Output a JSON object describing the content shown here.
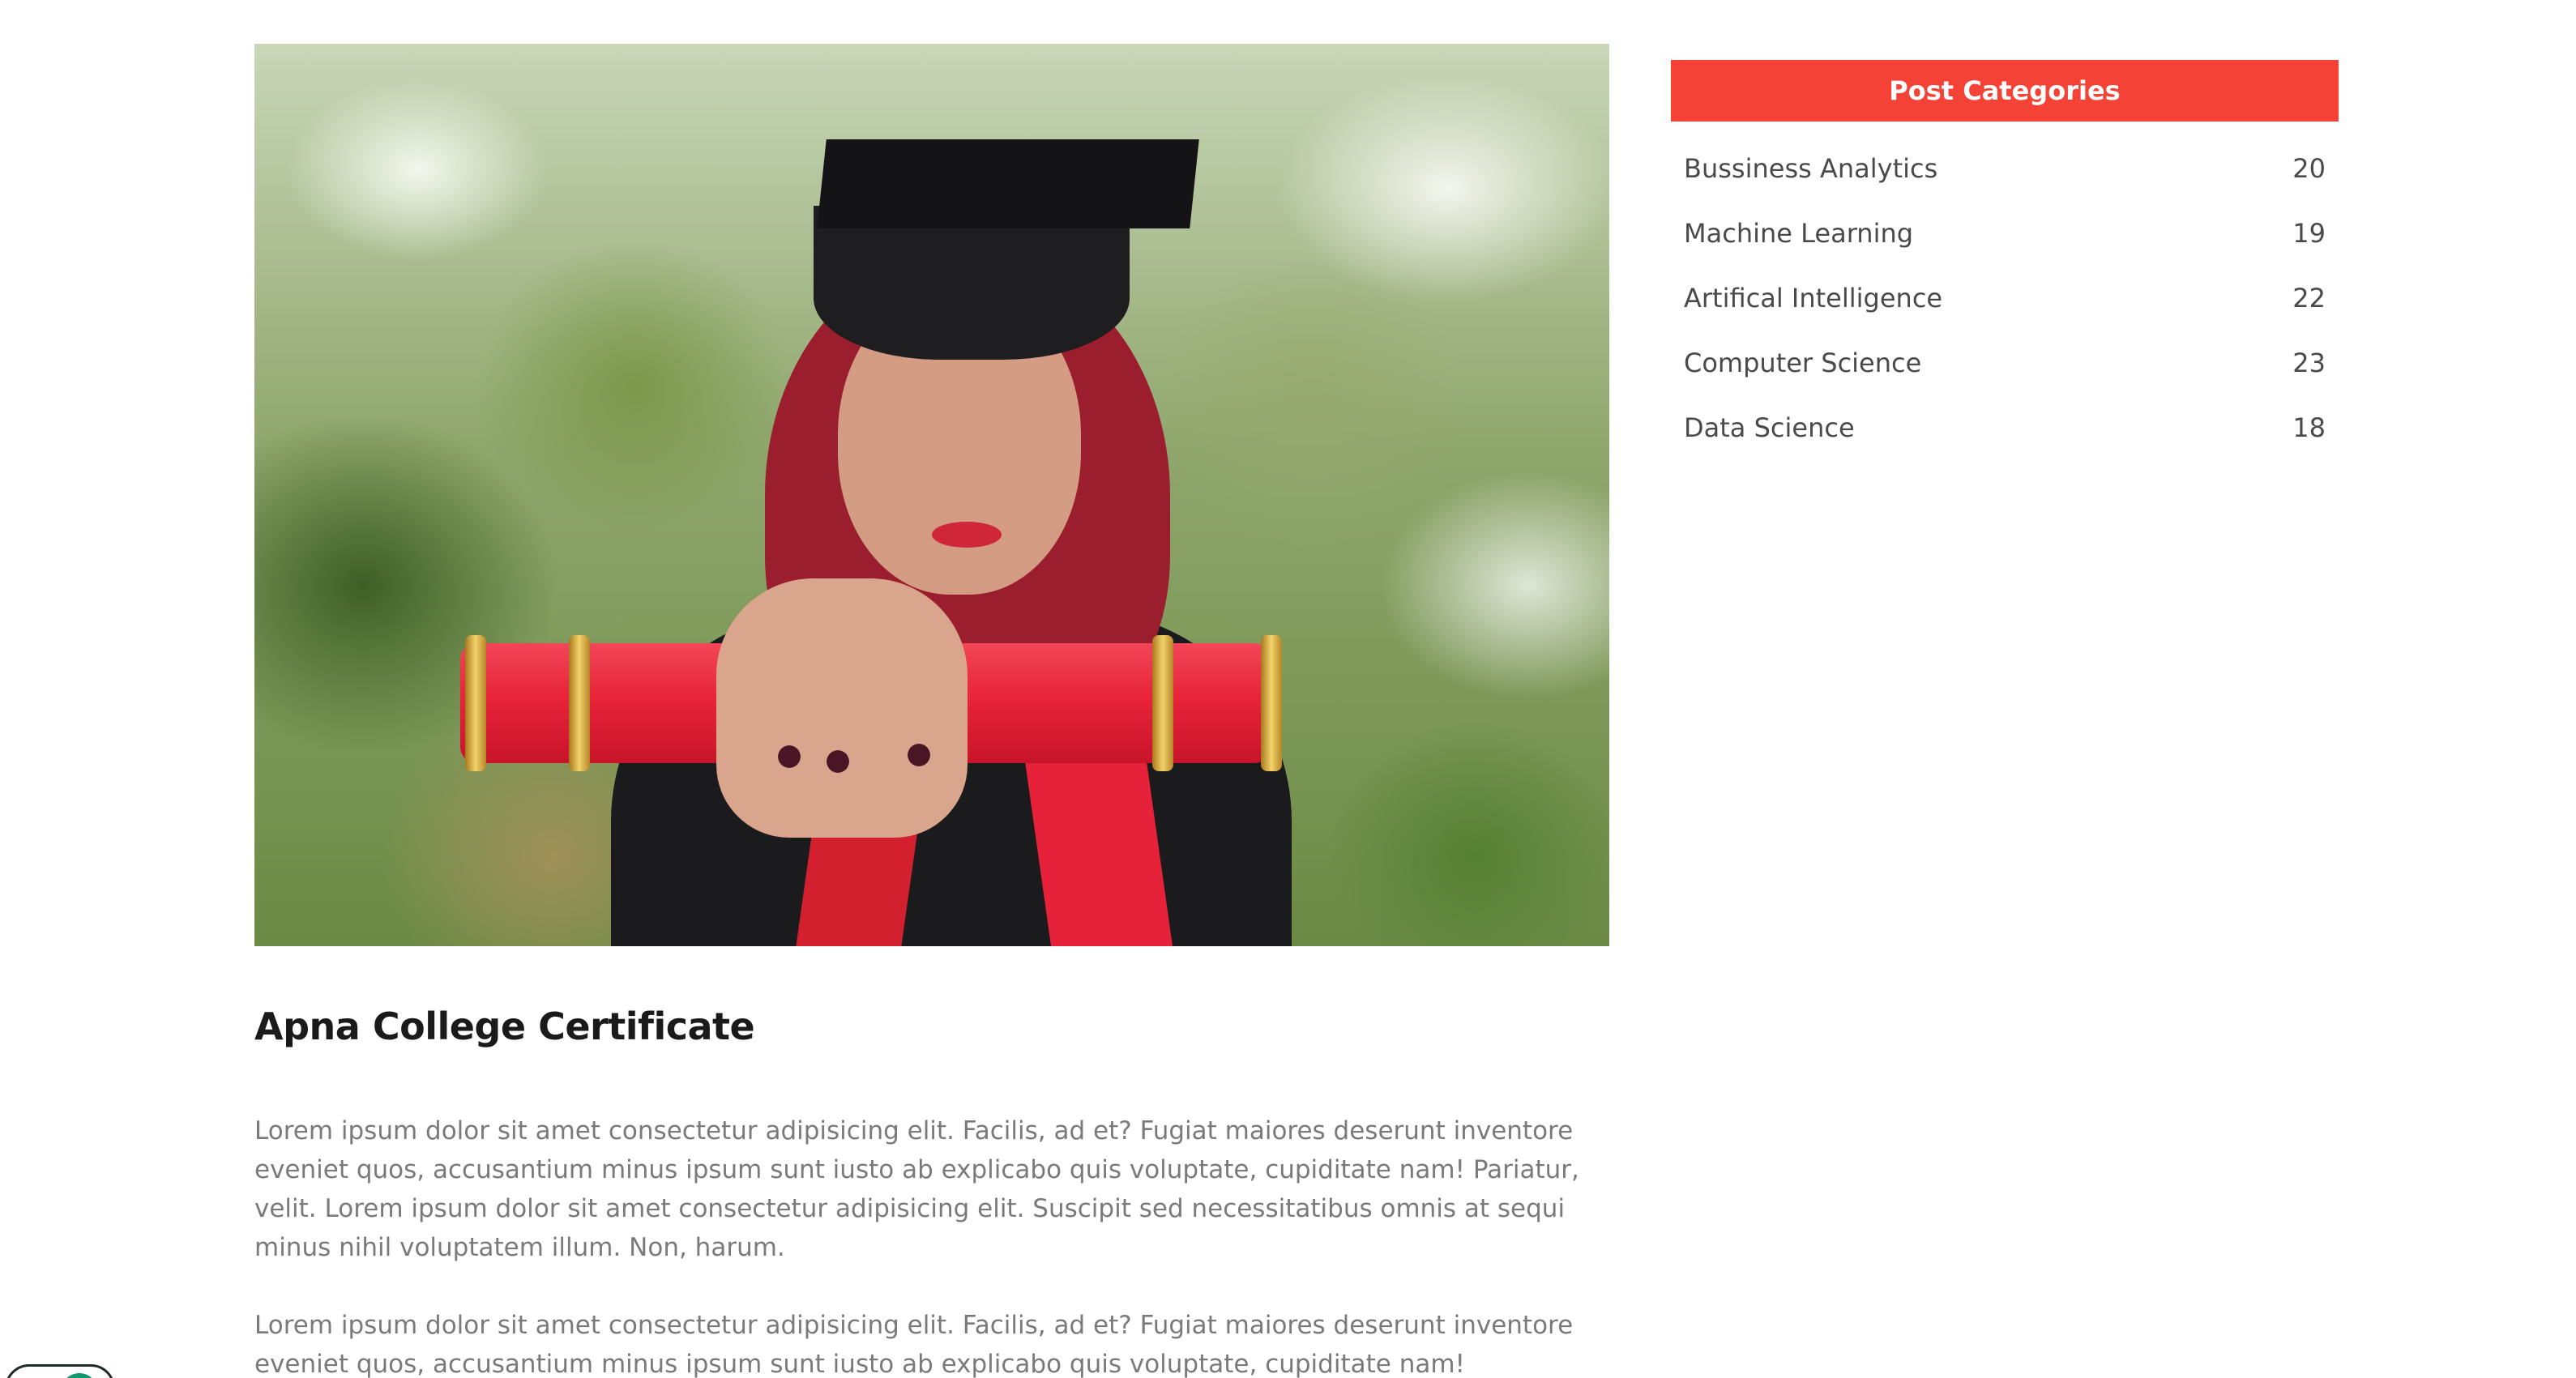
{
  "article": {
    "image_alt": "Graduate holding a red diploma scroll",
    "title": "Apna College Certificate",
    "paragraphs": [
      "Lorem ipsum dolor sit amet consectetur adipisicing elit. Facilis, ad et? Fugiat maiores deserunt inventore eveniet quos, accusantium minus ipsum sunt iusto ab explicabo quis voluptate, cupiditate nam! Pariatur, velit. Lorem ipsum dolor sit amet consectetur adipisicing elit. Suscipit sed necessitatibus omnis at sequi minus nihil voluptatem illum. Non, harum.",
      "Lorem ipsum dolor sit amet consectetur adipisicing elit. Facilis, ad et? Fugiat maiores deserunt inventore eveniet quos, accusantium minus ipsum sunt iusto ab explicabo quis voluptate, cupiditate nam!"
    ]
  },
  "sidebar": {
    "heading": "Post Categories",
    "categories": [
      {
        "label": "Bussiness Analytics",
        "count": "20"
      },
      {
        "label": "Machine Learning",
        "count": "19"
      },
      {
        "label": "Artifical Intelligence",
        "count": "22"
      },
      {
        "label": "Computer Science",
        "count": "23"
      },
      {
        "label": "Data Science",
        "count": "18"
      }
    ]
  },
  "colors": {
    "accent": "#f44336",
    "title_text": "#1a1a1a",
    "body_text": "#7a7a7a",
    "widget_accent": "#0e9a6e"
  },
  "icons": {
    "chat_widget": "chat-widget-icon"
  }
}
